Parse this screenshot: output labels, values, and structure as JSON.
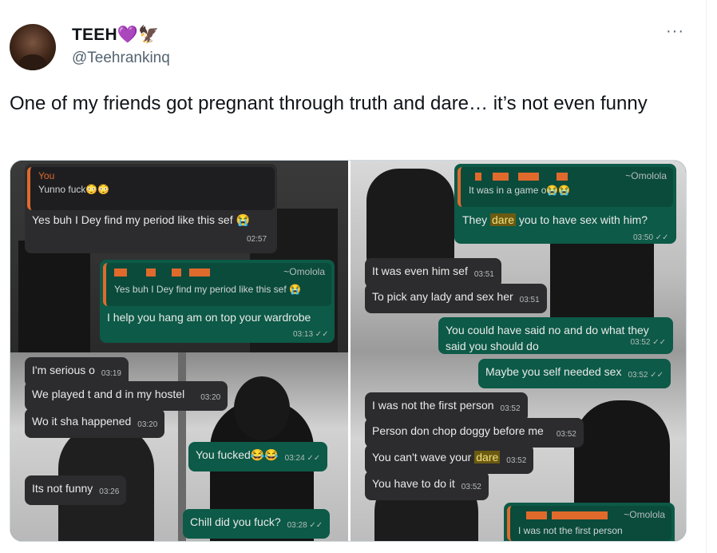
{
  "tweet": {
    "author_name": "TEEH",
    "author_emoji": "💜🦅",
    "handle": "@Teehrankinq",
    "more": "···",
    "text": "One of my friends got pregnant through truth and dare… it’s not even funny"
  },
  "left_chat": {
    "quote1": {
      "sender": "You",
      "text": "Yunno fuck😳😳"
    },
    "msg1": {
      "text": "Yes buh I Dey find my period like this sef 😭",
      "time": "02:57"
    },
    "quote2": {
      "name": "~Omolola",
      "text": "Yes buh I Dey find my period like this sef 😭"
    },
    "msg2": {
      "text": "I help you hang am on top your wardrobe",
      "time": "03:13 ✓✓"
    },
    "msg3": {
      "text": "I'm serious o",
      "time": "03:19"
    },
    "msg4": {
      "text": "We played t and d in my hostel",
      "time": "03:20"
    },
    "msg5": {
      "text": "Wo it sha happened",
      "time": "03:20"
    },
    "msg6": {
      "text": "You fucked😂😂",
      "time": "03:24 ✓✓"
    },
    "msg7": {
      "text": "Its not funny",
      "time": "03:26"
    },
    "msg8": {
      "text": "Chill did you fuck?",
      "time": "03:28 ✓✓"
    }
  },
  "right_chat": {
    "quote1": {
      "name": "~Omolola",
      "text": "It was in a game o😭😭"
    },
    "msg1": {
      "pre": "They ",
      "highlight": "dare",
      "post": " you to have sex with him?",
      "time": "03:50 ✓✓"
    },
    "msg2": {
      "text": "It was even him sef",
      "time": "03:51"
    },
    "msg3": {
      "text": "To pick any lady and sex her",
      "time": "03:51"
    },
    "msg4": {
      "text": "You could have said no and do what they said you should do",
      "time": "03:52 ✓✓"
    },
    "msg5": {
      "text": "Maybe you self needed sex",
      "time": "03:52 ✓✓"
    },
    "msg6": {
      "text": "I was not the first person",
      "time": "03:52"
    },
    "msg7": {
      "text": "Person don chop doggy before me",
      "time": "03:52"
    },
    "msg8": {
      "pre": "You can't wave your ",
      "highlight": "dare",
      "time": "03:52"
    },
    "msg9": {
      "text": "You have to do it",
      "time": "03:52"
    },
    "quote2": {
      "name": "~Omolola",
      "text": "I was not the first person"
    }
  }
}
